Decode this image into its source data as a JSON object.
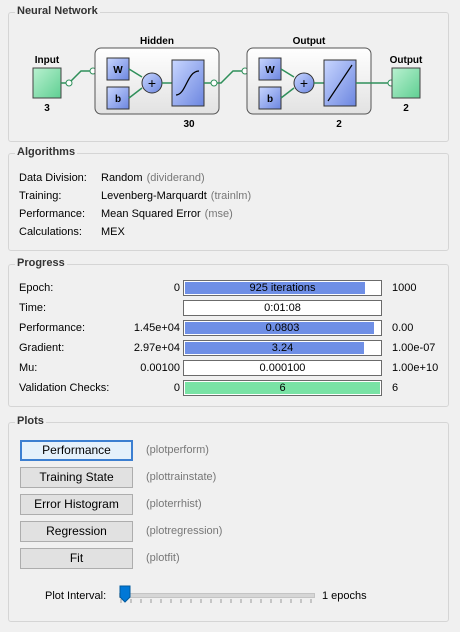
{
  "network": {
    "title": "Neural Network",
    "input_label": "Input",
    "input_size": "3",
    "hidden_label": "Hidden",
    "hidden_size": "30",
    "output_layer_label": "Output",
    "output_layer_size": "2",
    "output_label": "Output",
    "output_size": "2",
    "w_label": "W",
    "b_label": "b",
    "plus": "+"
  },
  "algorithms": {
    "title": "Algorithms",
    "rows": [
      {
        "key": "Data Division:",
        "value": "Random",
        "fn": "(dividerand)"
      },
      {
        "key": "Training:",
        "value": "Levenberg-Marquardt",
        "fn": "(trainlm)"
      },
      {
        "key": "Performance:",
        "value": "Mean Squared Error",
        "fn": "(mse)"
      },
      {
        "key": "Calculations:",
        "value": "MEX",
        "fn": ""
      }
    ]
  },
  "progress": {
    "title": "Progress",
    "rows": [
      {
        "key": "Epoch:",
        "min": "0",
        "text": "925 iterations",
        "max": "1000",
        "fill": 0.925,
        "color": "#6f8fe6"
      },
      {
        "key": "Time:",
        "min": "",
        "text": "0:01:08",
        "max": "",
        "fill": 0,
        "color": "#6f8fe6"
      },
      {
        "key": "Performance:",
        "min": "1.45e+04",
        "text": "0.0803",
        "max": "0.00",
        "fill": 0.97,
        "color": "#6f8fe6"
      },
      {
        "key": "Gradient:",
        "min": "2.97e+04",
        "text": "3.24",
        "max": "1.00e-07",
        "fill": 0.92,
        "color": "#6f8fe6"
      },
      {
        "key": "Mu:",
        "min": "0.00100",
        "text": "0.000100",
        "max": "1.00e+10",
        "fill": 0,
        "color": "#6f8fe6"
      },
      {
        "key": "Validation Checks:",
        "min": "0",
        "text": "6",
        "max": "6",
        "fill": 1.0,
        "color": "#79e3a5"
      }
    ]
  },
  "plots": {
    "title": "Plots",
    "buttons": [
      {
        "label": "Performance",
        "fn": "(plotperform)"
      },
      {
        "label": "Training State",
        "fn": "(plottrainstate)"
      },
      {
        "label": "Error Histogram",
        "fn": "(ploterrhist)"
      },
      {
        "label": "Regression",
        "fn": "(plotregression)"
      },
      {
        "label": "Fit",
        "fn": "(plotfit)"
      }
    ],
    "interval_label": "Plot Interval:",
    "interval_value": "1 epochs",
    "interval_level": 0
  }
}
